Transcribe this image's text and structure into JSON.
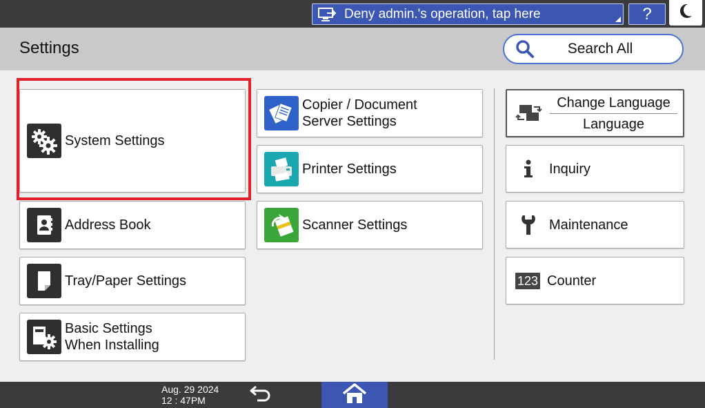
{
  "topbar": {
    "deny_label": "Deny admin.'s operation, tap here",
    "help_label": "?"
  },
  "header": {
    "title": "Settings",
    "search_label": "Search All"
  },
  "tiles": {
    "system_settings": "System Settings",
    "address_book": "Address Book",
    "tray_paper": "Tray/Paper Settings",
    "basic_line1": "Basic Settings",
    "basic_line2": "When Installing",
    "copier_line1": "Copier / Document",
    "copier_line2": "Server Settings",
    "printer": "Printer Settings",
    "scanner": "Scanner Settings"
  },
  "right": {
    "change_language": "Change Language",
    "language": "Language",
    "inquiry": "Inquiry",
    "maintenance": "Maintenance",
    "counter": "Counter",
    "counter_icon_text": "123"
  },
  "bottombar": {
    "date": "Aug. 29 2024",
    "time": "12 : 47PM"
  },
  "colors": {
    "accent_blue": "#3b57b3",
    "highlight_red": "#e0202a",
    "bar_dark": "#3b3b3e"
  }
}
